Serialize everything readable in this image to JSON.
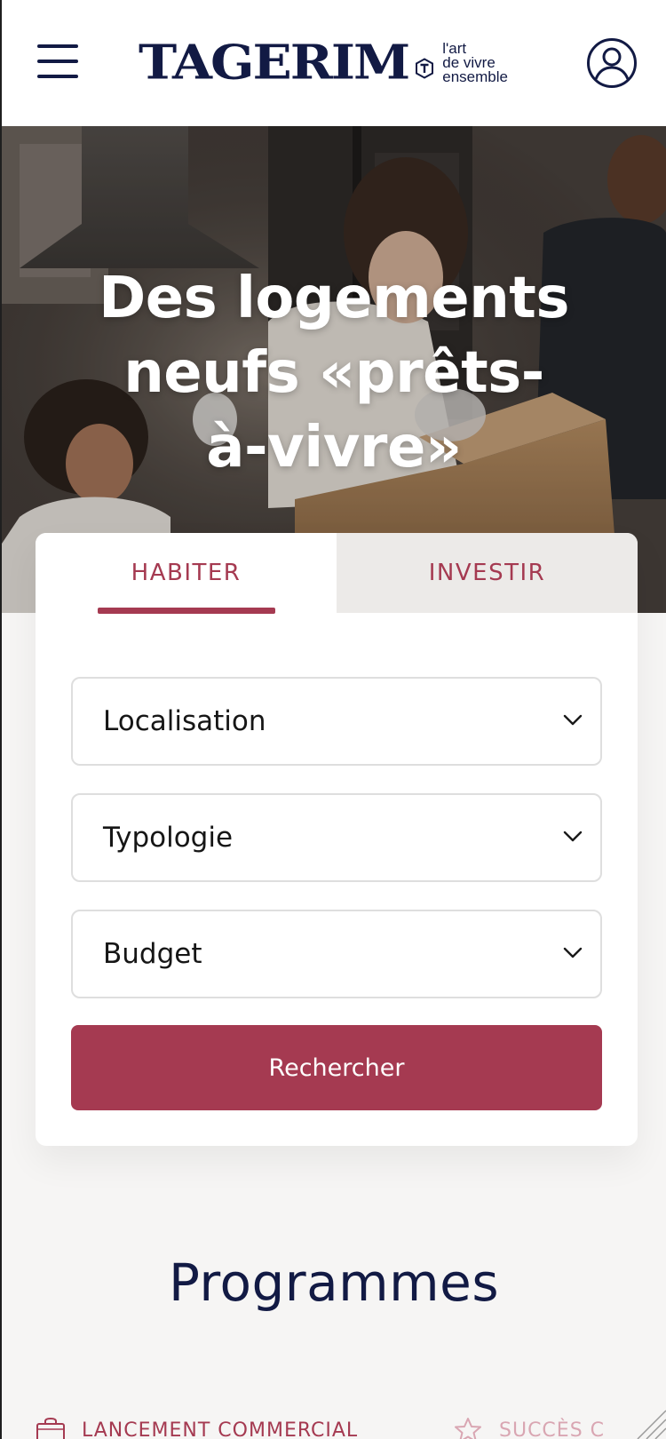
{
  "header": {
    "menu_icon": "hamburger-menu-icon",
    "logo": {
      "word": "TAGERIM",
      "tagline_lines": [
        "l'art",
        "de vivre",
        "ensemble"
      ]
    },
    "account_icon": "user-account-icon"
  },
  "hero": {
    "title_lines": [
      "Des logements",
      "neufs «prêts-",
      "à-vivre»"
    ]
  },
  "search": {
    "tabs": [
      {
        "label": "HABITER",
        "active": true
      },
      {
        "label": "INVESTIR",
        "active": false
      }
    ],
    "fields": [
      {
        "label": "Localisation"
      },
      {
        "label": "Typologie"
      },
      {
        "label": "Budget"
      }
    ],
    "submit_label": "Rechercher"
  },
  "programmes": {
    "title": "Programmes",
    "tabs": [
      {
        "label": "LANCEMENT COMMERCIAL",
        "icon": "shopping-bag-icon",
        "active": true
      },
      {
        "label": "SUCCÈS C",
        "icon": "star-icon",
        "active": false
      }
    ]
  },
  "colors": {
    "brand_navy": "#121a44",
    "accent_crimson": "#a53a51",
    "accent_pale": "#d9a6b2"
  }
}
